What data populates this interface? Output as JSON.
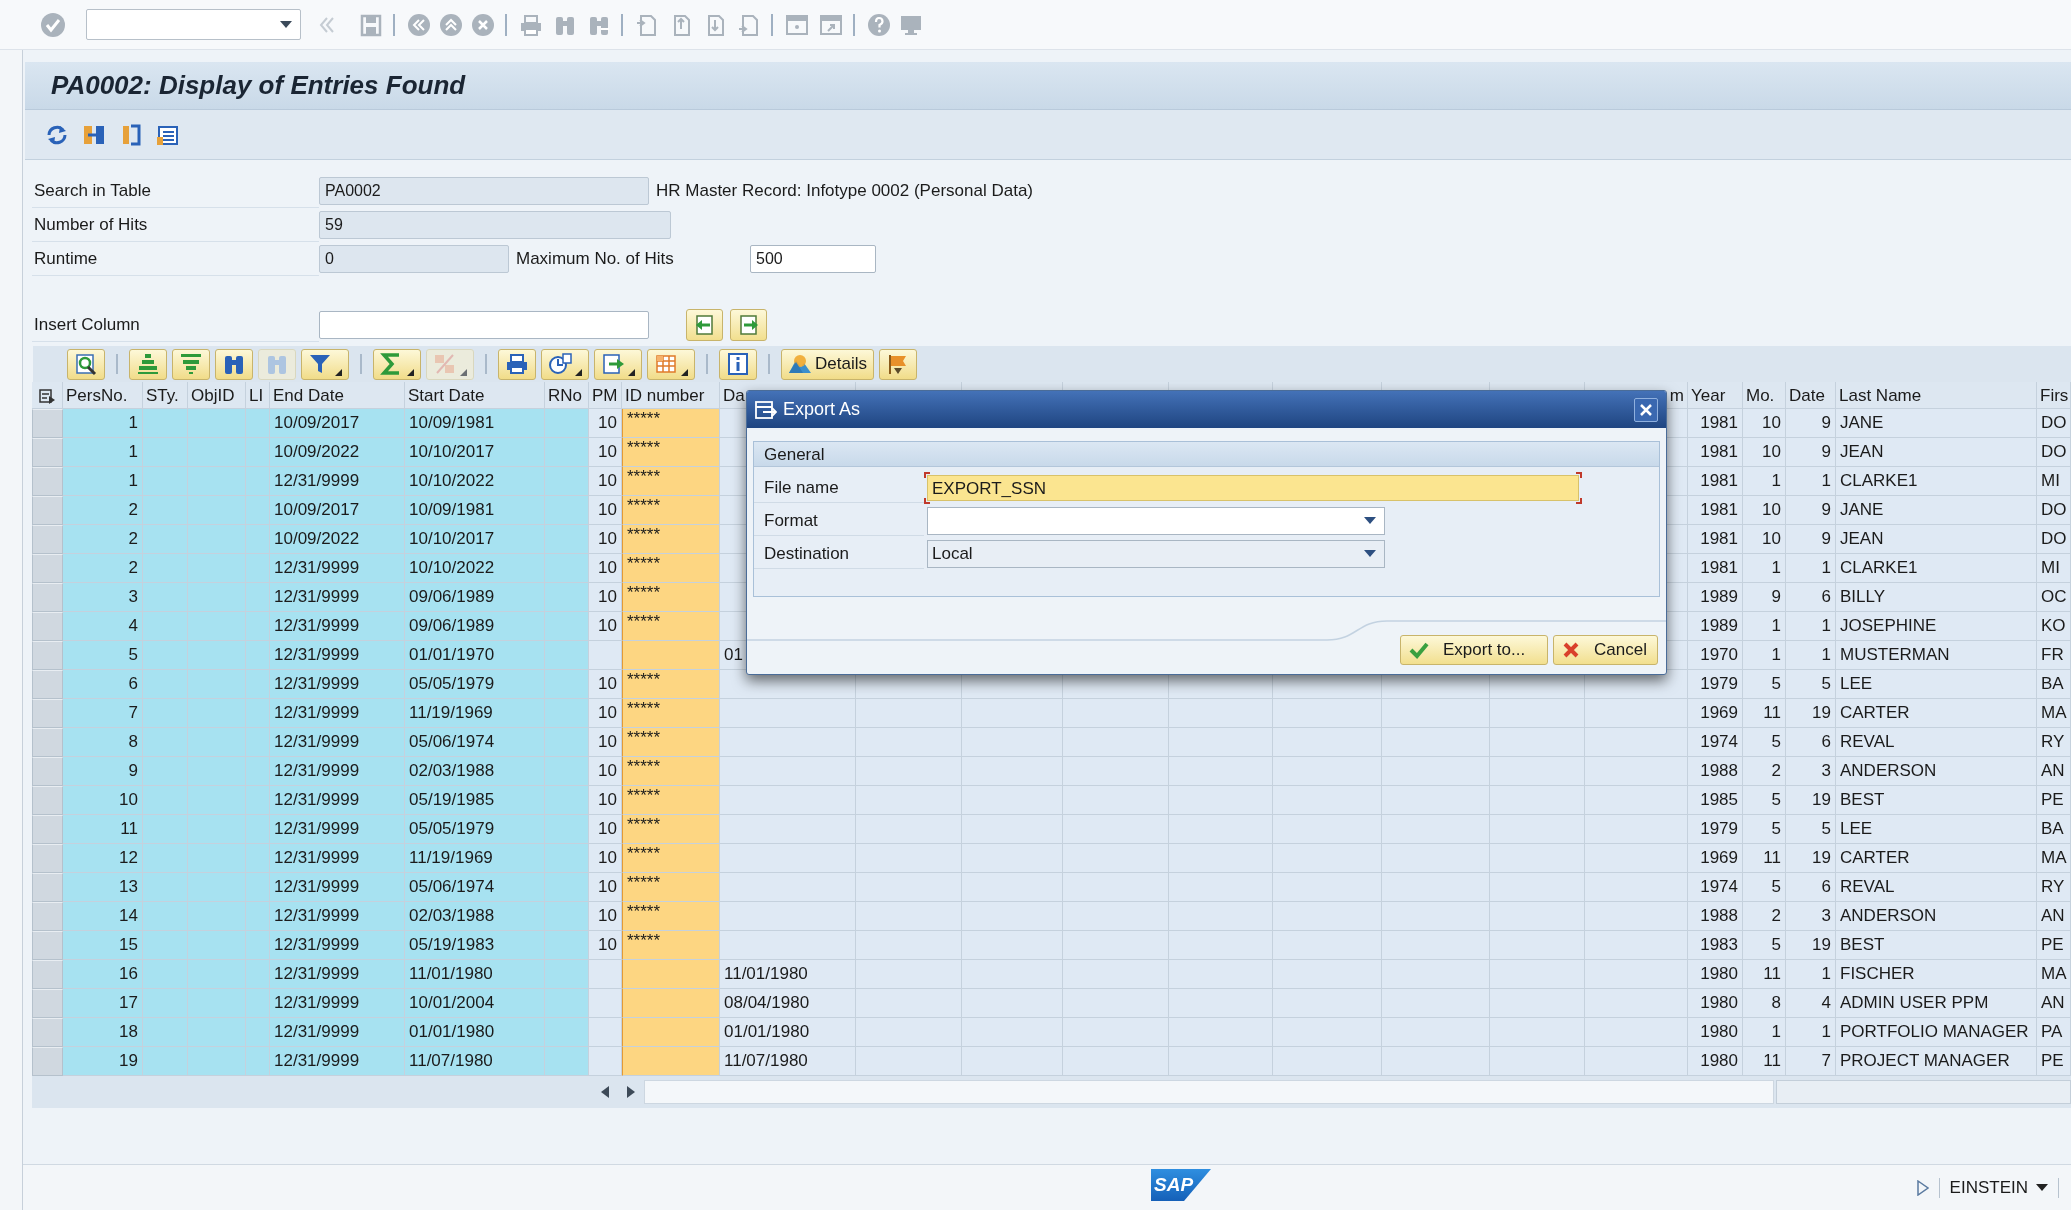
{
  "window": {
    "title": "PA0002: Display of Entries Found"
  },
  "form": {
    "search_in_table": {
      "label": "Search in Table",
      "value": "PA0002",
      "editable": false,
      "description": "HR Master Record: Infotype 0002 (Personal Data)"
    },
    "number_of_hits": {
      "label": "Number of Hits",
      "value": "59",
      "editable": false
    },
    "runtime": {
      "label": "Runtime",
      "value": "0",
      "editable": false
    },
    "max_hits": {
      "label": "Maximum No. of Hits",
      "value": "500",
      "editable": true
    },
    "insert_column": {
      "label": "Insert Column",
      "editable": true
    }
  },
  "alv_toolbar": [
    {
      "kind": "icon",
      "disabled": false
    },
    {
      "kind": "icon",
      "disabled": false
    },
    {
      "kind": "icon",
      "disabled": false
    },
    {
      "kind": "icon",
      "disabled": false
    },
    {
      "kind": "icon",
      "disabled": true
    },
    {
      "kind": "menu",
      "disabled": false
    },
    {
      "kind": "menu",
      "disabled": false
    },
    {
      "kind": "menu",
      "disabled": true
    },
    {
      "kind": "icon",
      "disabled": false
    },
    {
      "kind": "menu",
      "disabled": false
    },
    {
      "kind": "menu",
      "disabled": false
    },
    {
      "kind": "menu",
      "disabled": false
    },
    {
      "kind": "icon",
      "disabled": false
    },
    {
      "kind": "text",
      "label": "Details",
      "disabled": false
    },
    {
      "kind": "icon",
      "disabled": false
    }
  ],
  "table": {
    "columns": [
      {
        "label": "PersNo.",
        "kind": "key"
      },
      {
        "label": "STy.",
        "kind": "key"
      },
      {
        "label": "ObjID",
        "kind": "key"
      },
      {
        "label": "LI",
        "kind": "key"
      },
      {
        "label": "End Date",
        "kind": "key"
      },
      {
        "label": "Start Date",
        "kind": "key"
      },
      {
        "label": "RNo",
        "kind": "key"
      },
      {
        "label": "PM",
        "kind": "plain"
      },
      {
        "label": "ID number",
        "kind": "highlight"
      },
      {
        "label": "Da",
        "kind": "plain"
      },
      {
        "kind": "plain"
      },
      {
        "kind": "plain"
      },
      {
        "kind": "plain"
      },
      {
        "kind": "plain"
      },
      {
        "kind": "plain"
      },
      {
        "kind": "plain"
      },
      {
        "kind": "plain"
      },
      {
        "label": "m",
        "kind": "plain"
      },
      {
        "label": "Year",
        "kind": "plain"
      },
      {
        "label": "Mo.",
        "kind": "plain"
      },
      {
        "label": "Date",
        "kind": "plain"
      },
      {
        "label": "Last Name",
        "kind": "plain"
      },
      {
        "label": "Firs",
        "kind": "plain"
      }
    ],
    "rows": [
      [
        "1",
        null,
        null,
        null,
        "10/09/2017",
        "10/09/1981",
        null,
        "10",
        "*****",
        null,
        null,
        null,
        null,
        null,
        null,
        null,
        null,
        null,
        "1981",
        "10",
        "9",
        "JANE",
        "DO"
      ],
      [
        "1",
        null,
        null,
        null,
        "10/09/2022",
        "10/10/2017",
        null,
        "10",
        "*****",
        null,
        null,
        null,
        null,
        null,
        null,
        null,
        null,
        null,
        "1981",
        "10",
        "9",
        "JEAN",
        "DO"
      ],
      [
        "1",
        null,
        null,
        null,
        "12/31/9999",
        "10/10/2022",
        null,
        "10",
        "*****",
        null,
        null,
        null,
        null,
        null,
        null,
        null,
        null,
        null,
        "1981",
        "1",
        "1",
        "CLARKE1",
        "MI"
      ],
      [
        "2",
        null,
        null,
        null,
        "10/09/2017",
        "10/09/1981",
        null,
        "10",
        "*****",
        null,
        null,
        null,
        null,
        null,
        null,
        null,
        null,
        null,
        "1981",
        "10",
        "9",
        "JANE",
        "DO"
      ],
      [
        "2",
        null,
        null,
        null,
        "10/09/2022",
        "10/10/2017",
        null,
        "10",
        "*****",
        null,
        null,
        null,
        null,
        null,
        null,
        null,
        null,
        null,
        "1981",
        "10",
        "9",
        "JEAN",
        "DO"
      ],
      [
        "2",
        null,
        null,
        null,
        "12/31/9999",
        "10/10/2022",
        null,
        "10",
        "*****",
        null,
        null,
        null,
        null,
        null,
        null,
        null,
        null,
        null,
        "1981",
        "1",
        "1",
        "CLARKE1",
        "MI"
      ],
      [
        "3",
        null,
        null,
        null,
        "12/31/9999",
        "09/06/1989",
        null,
        "10",
        "*****",
        null,
        null,
        null,
        null,
        null,
        null,
        null,
        null,
        null,
        "1989",
        "9",
        "6",
        "BILLY",
        "OC"
      ],
      [
        "4",
        null,
        null,
        null,
        "12/31/9999",
        "09/06/1989",
        null,
        "10",
        "*****",
        null,
        null,
        null,
        null,
        null,
        null,
        null,
        null,
        null,
        "1989",
        "1",
        "1",
        "JOSEPHINE",
        "KO"
      ],
      [
        "5",
        null,
        null,
        null,
        "12/31/9999",
        "01/01/1970",
        null,
        null,
        null,
        "01",
        null,
        null,
        null,
        null,
        null,
        null,
        null,
        null,
        "1970",
        "1",
        "1",
        "MUSTERMAN",
        "FR"
      ],
      [
        "6",
        null,
        null,
        null,
        "12/31/9999",
        "05/05/1979",
        null,
        "10",
        "*****",
        null,
        null,
        null,
        null,
        null,
        null,
        null,
        null,
        null,
        "1979",
        "5",
        "5",
        "LEE",
        "BA"
      ],
      [
        "7",
        null,
        null,
        null,
        "12/31/9999",
        "11/19/1969",
        null,
        "10",
        "*****",
        null,
        null,
        null,
        null,
        null,
        null,
        null,
        null,
        null,
        "1969",
        "11",
        "19",
        "CARTER",
        "MA"
      ],
      [
        "8",
        null,
        null,
        null,
        "12/31/9999",
        "05/06/1974",
        null,
        "10",
        "*****",
        null,
        null,
        null,
        null,
        null,
        null,
        null,
        null,
        null,
        "1974",
        "5",
        "6",
        "REVAL",
        "RY"
      ],
      [
        "9",
        null,
        null,
        null,
        "12/31/9999",
        "02/03/1988",
        null,
        "10",
        "*****",
        null,
        null,
        null,
        null,
        null,
        null,
        null,
        null,
        null,
        "1988",
        "2",
        "3",
        "ANDERSON",
        "AN"
      ],
      [
        "10",
        null,
        null,
        null,
        "12/31/9999",
        "05/19/1985",
        null,
        "10",
        "*****",
        null,
        null,
        null,
        null,
        null,
        null,
        null,
        null,
        null,
        "1985",
        "5",
        "19",
        "BEST",
        "PE"
      ],
      [
        "11",
        null,
        null,
        null,
        "12/31/9999",
        "05/05/1979",
        null,
        "10",
        "*****",
        null,
        null,
        null,
        null,
        null,
        null,
        null,
        null,
        null,
        "1979",
        "5",
        "5",
        "LEE",
        "BA"
      ],
      [
        "12",
        null,
        null,
        null,
        "12/31/9999",
        "11/19/1969",
        null,
        "10",
        "*****",
        null,
        null,
        null,
        null,
        null,
        null,
        null,
        null,
        null,
        "1969",
        "11",
        "19",
        "CARTER",
        "MA"
      ],
      [
        "13",
        null,
        null,
        null,
        "12/31/9999",
        "05/06/1974",
        null,
        "10",
        "*****",
        null,
        null,
        null,
        null,
        null,
        null,
        null,
        null,
        null,
        "1974",
        "5",
        "6",
        "REVAL",
        "RY"
      ],
      [
        "14",
        null,
        null,
        null,
        "12/31/9999",
        "02/03/1988",
        null,
        "10",
        "*****",
        null,
        null,
        null,
        null,
        null,
        null,
        null,
        null,
        null,
        "1988",
        "2",
        "3",
        "ANDERSON",
        "AN"
      ],
      [
        "15",
        null,
        null,
        null,
        "12/31/9999",
        "05/19/1983",
        null,
        "10",
        "*****",
        null,
        null,
        null,
        null,
        null,
        null,
        null,
        null,
        null,
        "1983",
        "5",
        "19",
        "BEST",
        "PE"
      ],
      [
        "16",
        null,
        null,
        null,
        "12/31/9999",
        "11/01/1980",
        null,
        null,
        null,
        "11/01/1980",
        null,
        null,
        null,
        null,
        null,
        null,
        null,
        null,
        "1980",
        "11",
        "1",
        "FISCHER",
        "MA"
      ],
      [
        "17",
        null,
        null,
        null,
        "12/31/9999",
        "10/01/2004",
        null,
        null,
        null,
        "08/04/1980",
        null,
        null,
        null,
        null,
        null,
        null,
        null,
        null,
        "1980",
        "8",
        "4",
        "ADMIN USER PPM",
        "AN"
      ],
      [
        "18",
        null,
        null,
        null,
        "12/31/9999",
        "01/01/1980",
        null,
        null,
        null,
        "01/01/1980",
        null,
        null,
        null,
        null,
        null,
        null,
        null,
        null,
        "1980",
        "1",
        "1",
        "PORTFOLIO MANAGER",
        "PA"
      ],
      [
        "19",
        null,
        null,
        null,
        "12/31/9999",
        "11/07/1980",
        null,
        null,
        null,
        "11/07/1980",
        null,
        null,
        null,
        null,
        null,
        null,
        null,
        null,
        "1980",
        "11",
        "7",
        "PROJECT MANAGER",
        "PE"
      ]
    ]
  },
  "dialog": {
    "title": "Export As",
    "group": "General",
    "fields": [
      {
        "label": "File name",
        "kind": "text",
        "value": "EXPORT_SSN",
        "focused": true
      },
      {
        "label": "Format",
        "kind": "dropdown",
        "focused": false
      },
      {
        "label": "Destination",
        "kind": "dropdown",
        "value": "Local",
        "focused": false
      }
    ],
    "buttons": [
      {
        "label": "Export to...",
        "kind": "confirm"
      },
      {
        "label": "Cancel",
        "kind": "cancel"
      }
    ]
  },
  "status_bar": {
    "logo": "SAP",
    "user": "EINSTEIN"
  }
}
